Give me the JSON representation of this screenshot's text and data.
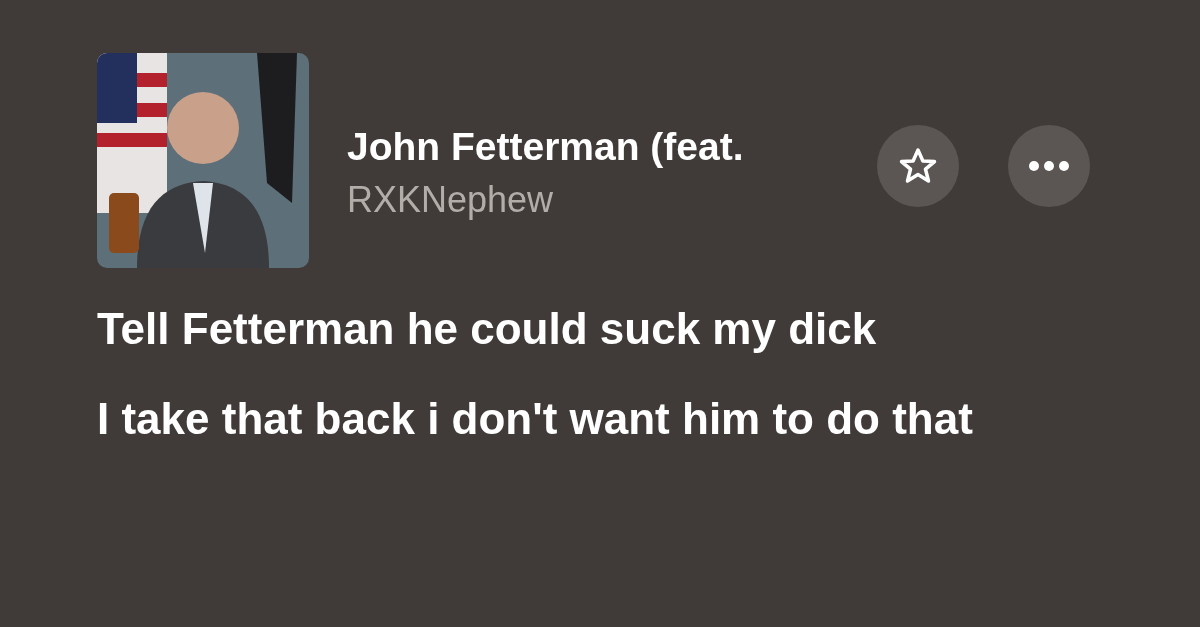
{
  "track": {
    "title": "John Fetterman (feat.",
    "artist": "RXKNephew"
  },
  "buttons": [
    {
      "kind": "favorite"
    },
    {
      "kind": "more"
    }
  ],
  "lyrics": [
    "Tell Fetterman he could suck my dick",
    "I take that back i don't want him to do that"
  ]
}
